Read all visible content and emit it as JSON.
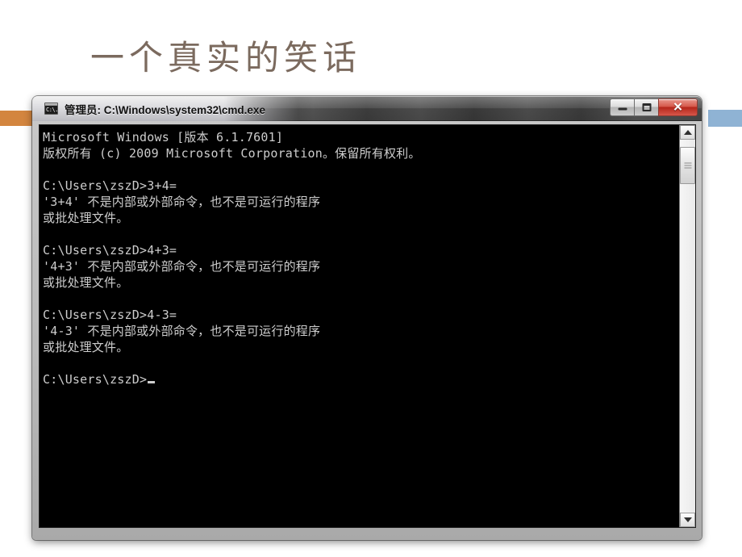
{
  "slide": {
    "title": "一个真实的笑话",
    "accent_left_color": "#d3853f",
    "accent_right_color": "#8fb3d4",
    "background_color": "#ffffff",
    "title_color": "#7b6a5e"
  },
  "window": {
    "icon_name": "cmd-exe-icon",
    "icon_glyph": "C:\\.",
    "title": "管理员: C:\\Windows\\system32\\cmd.exe",
    "buttons": {
      "minimize_label": "最小化",
      "maximize_label": "最大化",
      "close_label": "✕"
    }
  },
  "console": {
    "background_color": "#000000",
    "text_color": "#cdcdcd",
    "lines": [
      "Microsoft Windows [版本 6.1.7601]",
      "版权所有 (c) 2009 Microsoft Corporation。保留所有权利。",
      "",
      "C:\\Users\\zszD>3+4=",
      "'3+4' 不是内部或外部命令，也不是可运行的程序",
      "或批处理文件。",
      "",
      "C:\\Users\\zszD>4+3=",
      "'4+3' 不是内部或外部命令，也不是可运行的程序",
      "或批处理文件。",
      "",
      "C:\\Users\\zszD>4-3=",
      "'4-3' 不是内部或外部命令，也不是可运行的程序",
      "或批处理文件。",
      "",
      "C:\\Users\\zszD>"
    ],
    "prompt_line_index": 15,
    "cursor": "_"
  },
  "scrollbar": {
    "up_arrow": "▲",
    "down_arrow": "▼",
    "thumb_position_percent": 2
  }
}
